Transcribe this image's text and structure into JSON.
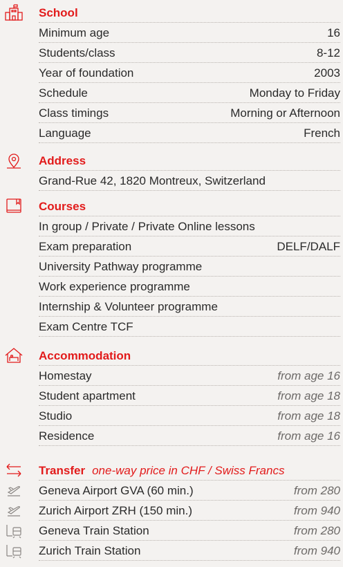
{
  "colors": {
    "accent": "#e21b1b",
    "text": "#2a2a2a",
    "muted": "#6d6a68",
    "background": "#f4f2f0"
  },
  "school": {
    "title": "School",
    "icon": "school-building-icon",
    "rows": [
      {
        "label": "Minimum age",
        "value": "16"
      },
      {
        "label": "Students/class",
        "value": "8-12"
      },
      {
        "label": "Year of foundation",
        "value": "2003"
      },
      {
        "label": "Schedule",
        "value": "Monday to Friday"
      },
      {
        "label": "Class timings",
        "value": "Morning or Afternoon"
      },
      {
        "label": "Language",
        "value": "French"
      }
    ]
  },
  "address": {
    "title": "Address",
    "icon": "map-pin-icon",
    "text": "Grand-Rue 42, 1820 Montreux, Switzerland"
  },
  "courses": {
    "title": "Courses",
    "icon": "book-icon",
    "rows": [
      {
        "label": "In group / Private / Private Online lessons",
        "value": ""
      },
      {
        "label": "Exam preparation",
        "value": "DELF/DALF"
      },
      {
        "label": "University Pathway programme",
        "value": ""
      },
      {
        "label": "Work experience programme",
        "value": ""
      },
      {
        "label": "Internship & Volunteer programme",
        "value": ""
      },
      {
        "label": "Exam Centre TCF",
        "value": ""
      }
    ]
  },
  "accommodation": {
    "title": "Accommodation",
    "icon": "house-bed-icon",
    "rows": [
      {
        "label": "Homestay",
        "value": "from age 16"
      },
      {
        "label": "Student apartment",
        "value": "from age 18"
      },
      {
        "label": "Studio",
        "value": "from age 18"
      },
      {
        "label": "Residence",
        "value": "from age 16"
      }
    ]
  },
  "transfer": {
    "title": "Transfer",
    "subtitle": "one-way price in CHF / Swiss Francs",
    "icon": "two-way-arrows-icon",
    "rows": [
      {
        "label": "Geneva Airport GVA (60 min.)",
        "value": "from 280",
        "icon": "plane-icon"
      },
      {
        "label": "Zurich Airport ZRH (150 min.)",
        "value": "from 940",
        "icon": "plane-icon"
      },
      {
        "label": "Geneva Train Station",
        "value": "from 280",
        "icon": "train-icon"
      },
      {
        "label": "Zurich Train Station",
        "value": "from 940",
        "icon": "train-icon"
      }
    ]
  }
}
